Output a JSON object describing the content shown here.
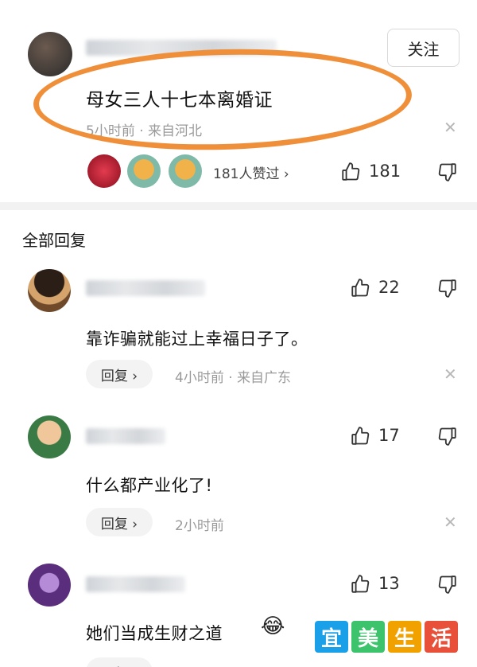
{
  "post": {
    "follow_label": "关注",
    "text": "母女三人十七本离婚证",
    "meta": "5小时前 · 来自河北",
    "likers_text": "181人赞过 ›",
    "like_count": "181"
  },
  "section_title": "全部回复",
  "comments": [
    {
      "username_partial": "曾银",
      "likes": "22",
      "text": "靠诈骗就能过上幸福日子了。",
      "reply_label": "回复 ›",
      "meta": "4小时前 · 来自广东"
    },
    {
      "username_partial": "衡",
      "likes": "17",
      "text": "什么都产业化了!",
      "reply_label": "回复 ›",
      "meta": "2小时前"
    },
    {
      "username_partial": "幸运",
      "likes": "13",
      "text": "她们当成生财之道",
      "reply_label": "回复 ›",
      "meta": ""
    }
  ],
  "watermark": {
    "chars": [
      "宜",
      "美",
      "生",
      "活"
    ],
    "colors": [
      "#1aa0e8",
      "#3cc36b",
      "#f2a200",
      "#e8503a"
    ]
  }
}
